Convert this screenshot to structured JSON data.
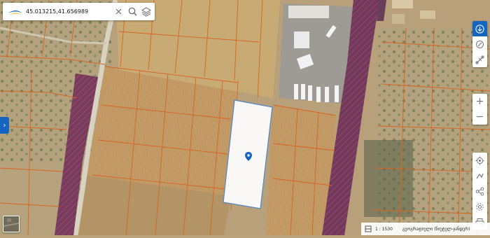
{
  "search": {
    "coordinates": "45.013215,41.656989",
    "logo_icon": "brand-logo-icon",
    "clear_icon": "close-icon",
    "search_icon": "search-icon",
    "layers_icon": "layers-icon"
  },
  "right_toolbar_top": [
    "download-icon",
    "draw-point-icon",
    "measure-icon"
  ],
  "zoom": {
    "in_label": "+",
    "out_label": "−"
  },
  "right_toolbar_bottom": [
    "locate-icon",
    "route-icon",
    "share-icon",
    "settings-icon",
    "print-icon"
  ],
  "left_toggle": {
    "label": "›",
    "icon": "chevron-right-icon"
  },
  "status": {
    "scale_icon": "scale-icon",
    "scale": "1 : 1530",
    "layer": "გეოგრაფიული (ნიუტელ-ჯანდერ)"
  },
  "colors": {
    "accent": "#1565c0",
    "parcel_border": "#d9641f",
    "selected_parcel": "#ffffff",
    "protected_zone": "#8a3b6b"
  }
}
